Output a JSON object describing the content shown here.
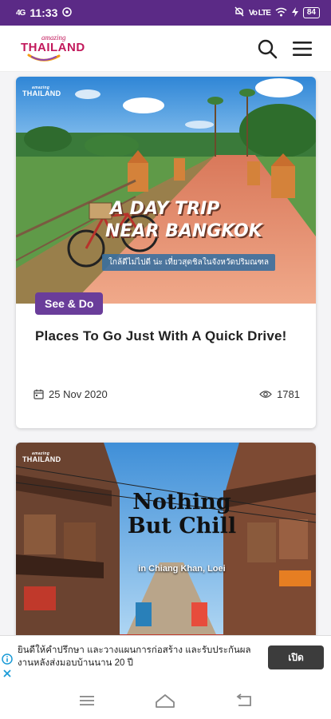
{
  "status_bar": {
    "time": "11:33",
    "signal_left": "4G",
    "volte": "Vo LTE",
    "battery": "84"
  },
  "header": {
    "logo_small": "amazing",
    "logo_big": "THAILAND",
    "icons": [
      "search-icon",
      "hamburger-menu-icon"
    ]
  },
  "cards": [
    {
      "image_brand": "THAILAND",
      "image_brand_small": "amazing",
      "image_headline_line1": "A Day Trip",
      "image_headline_line2": "Near Bangkok",
      "image_thai_text": "ใกล้ดีไม่ไปดี น่ะ เที่ยวสุดชิลในจังหวัดปริมณฑล",
      "category": "See & Do",
      "title": "Places To Go Just With A Quick Drive!",
      "date": "25 Nov 2020",
      "views": "1781",
      "accent": "#6a3d9a"
    },
    {
      "image_brand": "THAILAND",
      "image_brand_small": "amazing",
      "image_headline": "Nothing But Chill",
      "image_subheadline": "in Chiang Khan, Loei"
    }
  ],
  "ad": {
    "text": "ยินดีให้คำปรึกษา และวางแผนการก่อสร้าง และรับประกันผลงานหลังส่งมอบบ้านนาน 20 ปี",
    "button": "เปิด"
  },
  "nav": {
    "icons": [
      "recent-apps-icon",
      "home-icon",
      "back-icon"
    ]
  },
  "colors": {
    "status_bar": "#5b2a86",
    "brand_pink": "#c2185b",
    "category_purple": "#6a3d9a"
  }
}
